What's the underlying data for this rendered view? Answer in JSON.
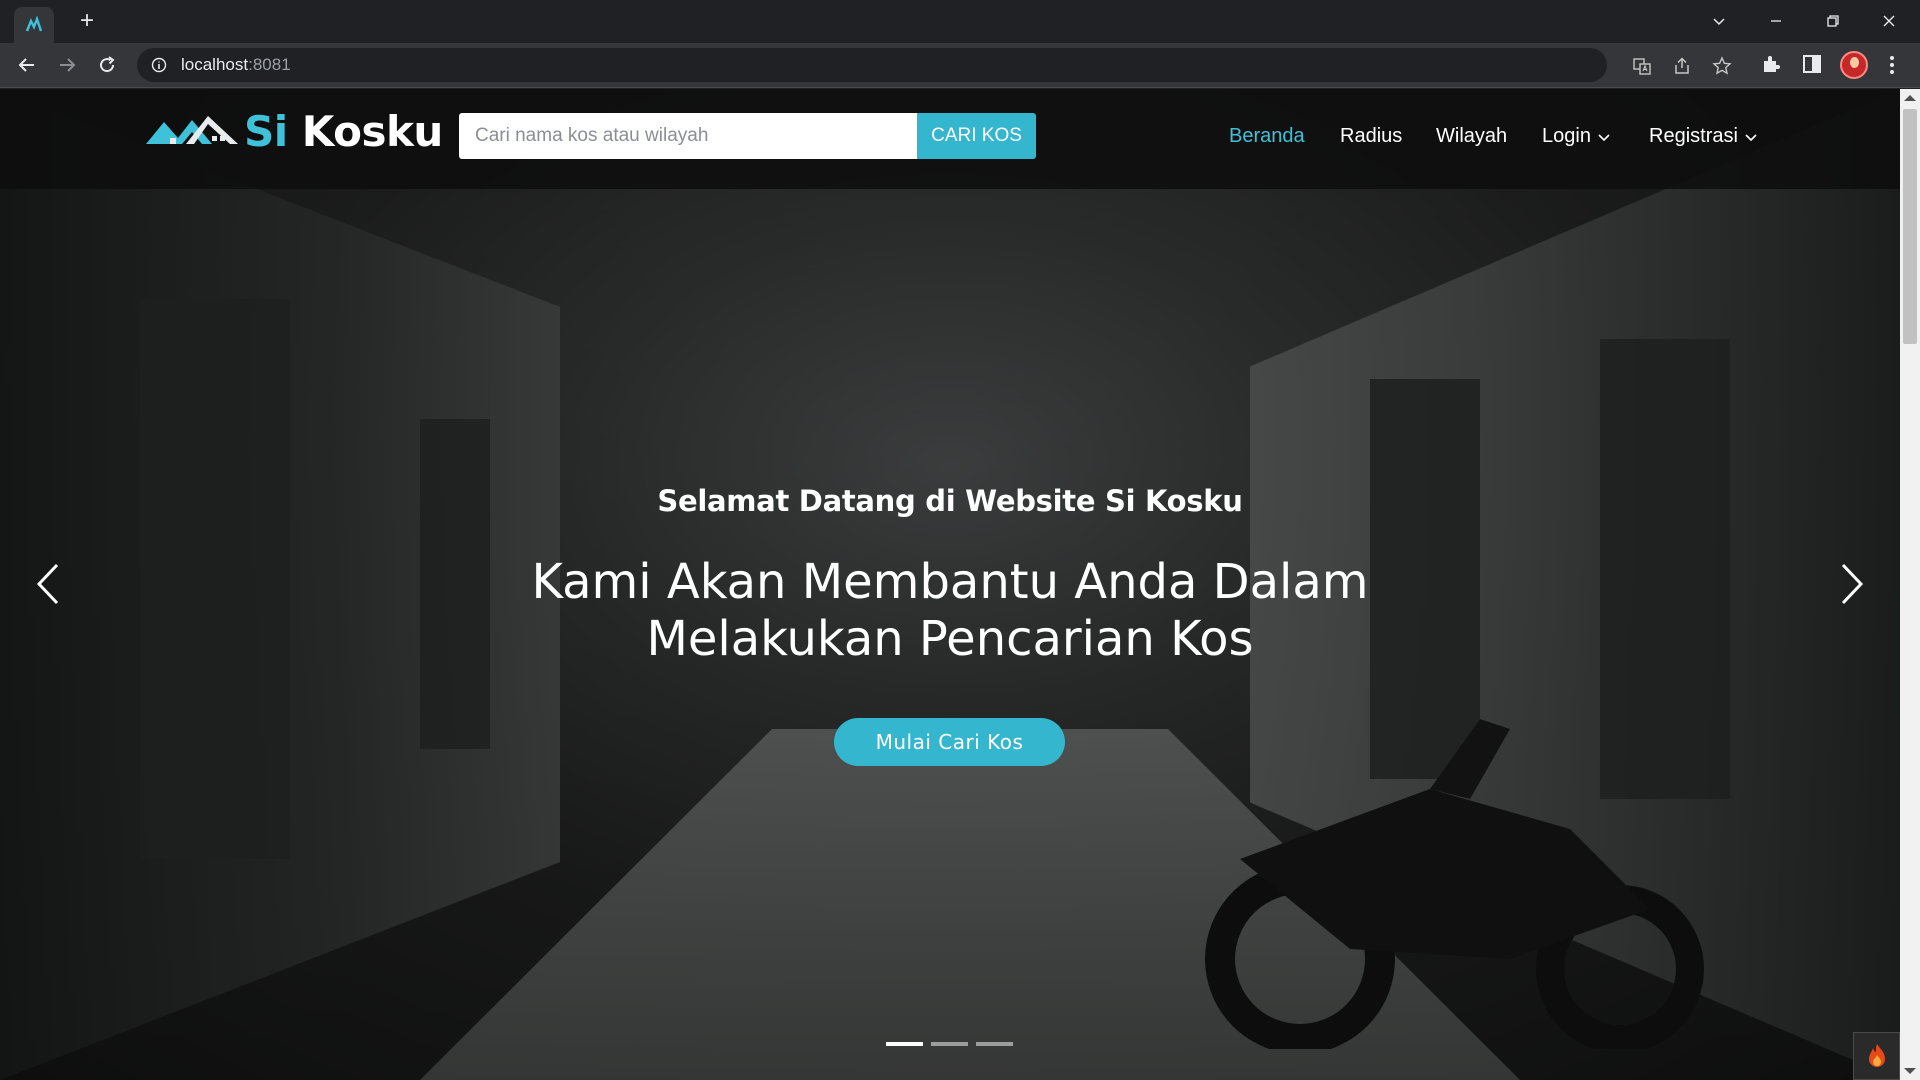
{
  "browser": {
    "url_host": "localhost",
    "url_port": ":8081",
    "icons": [
      "tab-favicon-icon",
      "new-tab-icon",
      "chevron-down-icon",
      "minimize-icon",
      "restore-icon",
      "close-icon",
      "back-icon",
      "forward-icon",
      "reload-icon",
      "info-icon",
      "translate-icon",
      "share-icon",
      "star-icon",
      "extensions-icon",
      "side-panel-icon",
      "profile-avatar",
      "more-icon"
    ]
  },
  "header": {
    "logo_part1": "Si",
    "logo_part2": "Kosku",
    "search_placeholder": "Cari nama kos atau wilayah",
    "search_button": "CARI KOS",
    "nav": {
      "beranda": "Beranda",
      "radius": "Radius",
      "wilayah": "Wilayah",
      "login": "Login",
      "registrasi": "Registrasi"
    },
    "colors": {
      "accent": "#3fc1d9",
      "button": "#35b6cf"
    }
  },
  "hero": {
    "kicker": "Selamat Datang di Website Si Kosku",
    "title": "Kami Akan Membantu Anda Dalam Melakukan Pencarian Kos",
    "cta": "Mulai Cari Kos",
    "active_slide": 1,
    "slide_count": 3
  }
}
